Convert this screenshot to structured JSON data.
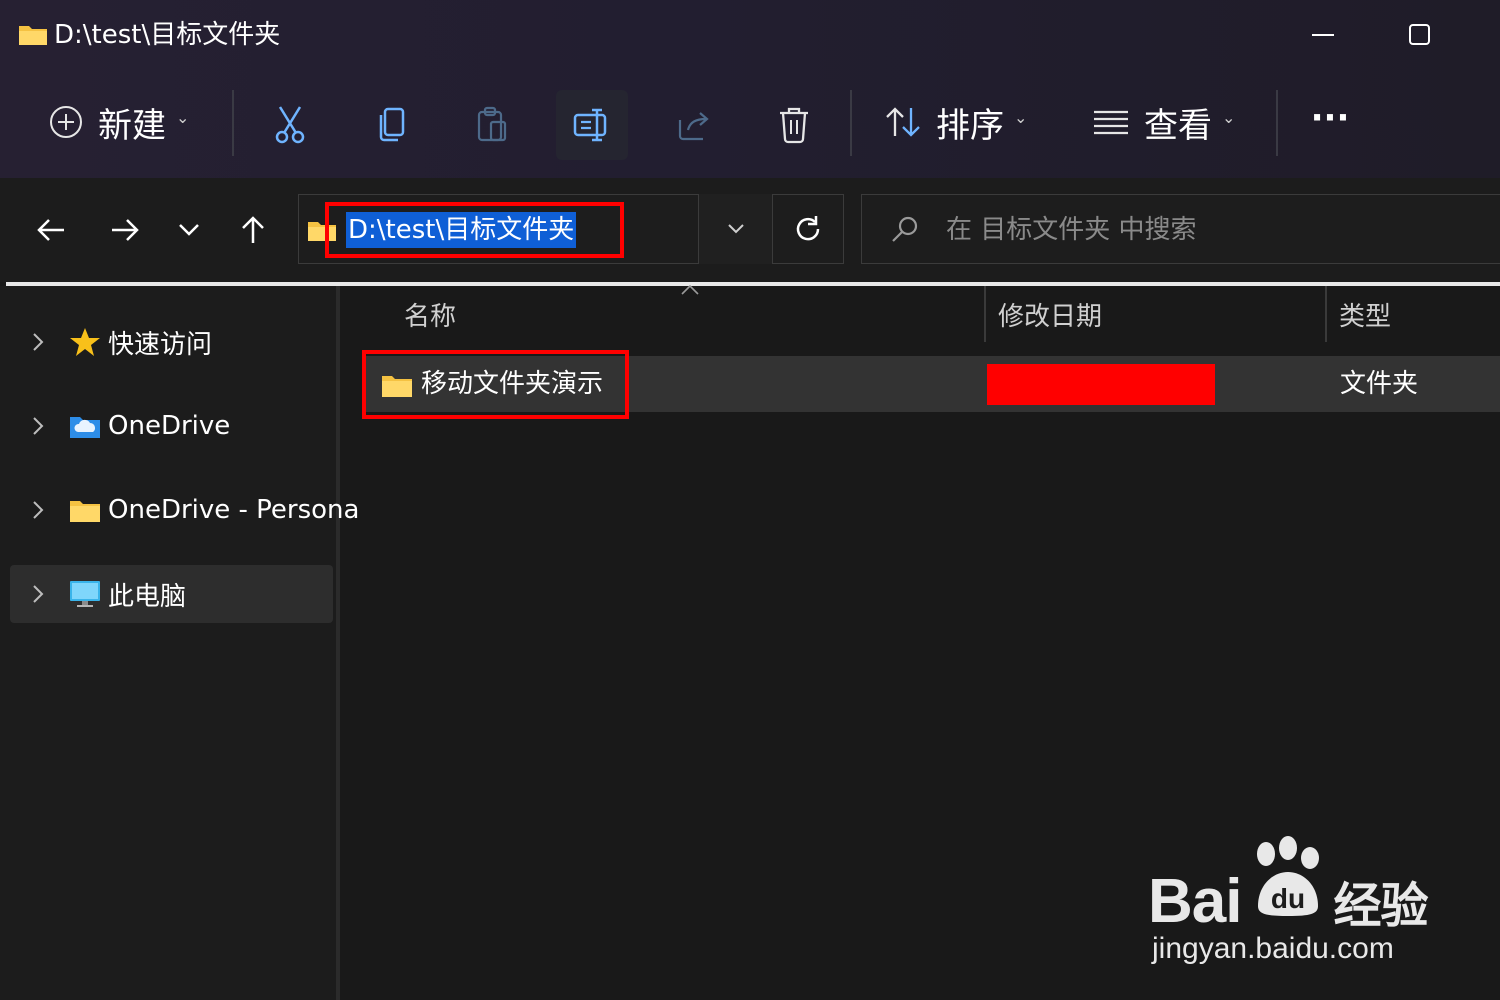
{
  "window": {
    "title": "D:\\test\\目标文件夹"
  },
  "toolbar": {
    "new_label": "新建",
    "sort_label": "排序",
    "view_label": "查看",
    "more_label": "···"
  },
  "address": {
    "path": "D:\\test\\目标文件夹"
  },
  "search": {
    "placeholder": "在 目标文件夹 中搜索"
  },
  "sidebar": {
    "items": [
      {
        "label": "快速访问",
        "icon": "star-icon"
      },
      {
        "label": "OneDrive",
        "icon": "onedrive-cloud-icon"
      },
      {
        "label": "OneDrive - Persona",
        "icon": "folder-icon"
      },
      {
        "label": "此电脑",
        "icon": "monitor-icon"
      }
    ]
  },
  "columns": {
    "name": "名称",
    "modified": "修改日期",
    "type": "类型"
  },
  "files": [
    {
      "name": "移动文件夹演示",
      "type": "文件夹"
    }
  ],
  "watermark": {
    "brand": "Bai",
    "brand_suffix": "经验",
    "url": "jingyan.baidu.com"
  },
  "colors": {
    "accent_blue": "#0f5fd6",
    "highlight_red": "#ff0000",
    "folder_yellow": "#f5c242"
  }
}
